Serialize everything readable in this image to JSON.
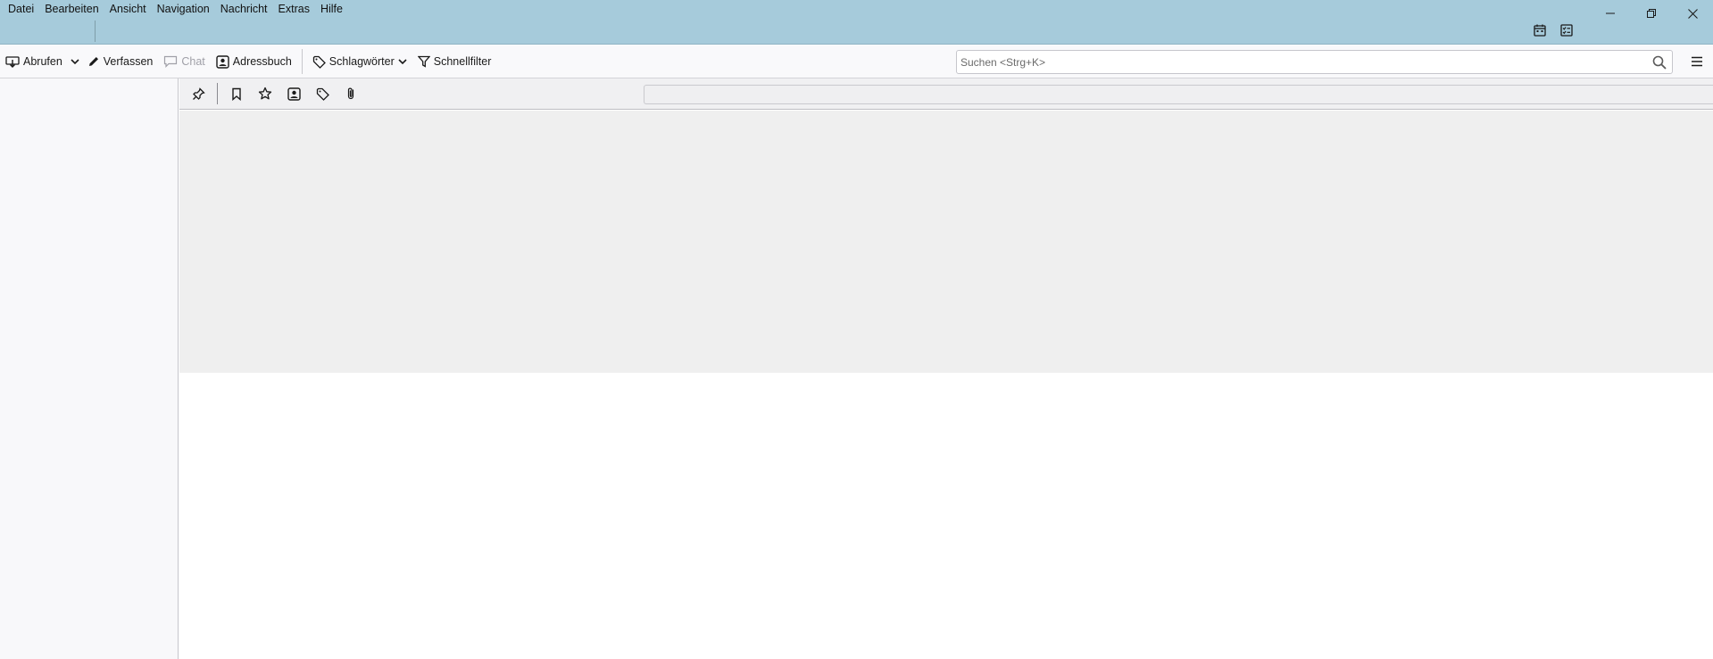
{
  "menubar": {
    "items": [
      {
        "label": "Datei"
      },
      {
        "label": "Bearbeiten"
      },
      {
        "label": "Ansicht"
      },
      {
        "label": "Navigation"
      },
      {
        "label": "Nachricht"
      },
      {
        "label": "Extras"
      },
      {
        "label": "Hilfe"
      }
    ]
  },
  "window_controls": {
    "icons": [
      "minimize-icon",
      "restore-icon",
      "close-icon"
    ]
  },
  "spaces": {
    "icons": [
      "calendar-icon",
      "tasks-icon"
    ]
  },
  "toolbar": {
    "get_messages": "Abrufen",
    "write": "Verfassen",
    "chat": "Chat",
    "address_book": "Adressbuch",
    "tags": "Schlagwörter",
    "quick_filter": "Schnellfilter",
    "search_placeholder": "Suchen <Strg+K>"
  },
  "quick_filter_bar": {
    "buttons": [
      "pin-icon",
      "bookmark-icon",
      "star-icon",
      "contact-icon",
      "tag-icon",
      "attachment-icon"
    ],
    "filter_value": ""
  },
  "colors": {
    "titlebar": "#a6cbdb",
    "toolbar": "#f9f9fb",
    "thread_pane": "#efefef",
    "folder_pane": "#f8f8fa"
  }
}
